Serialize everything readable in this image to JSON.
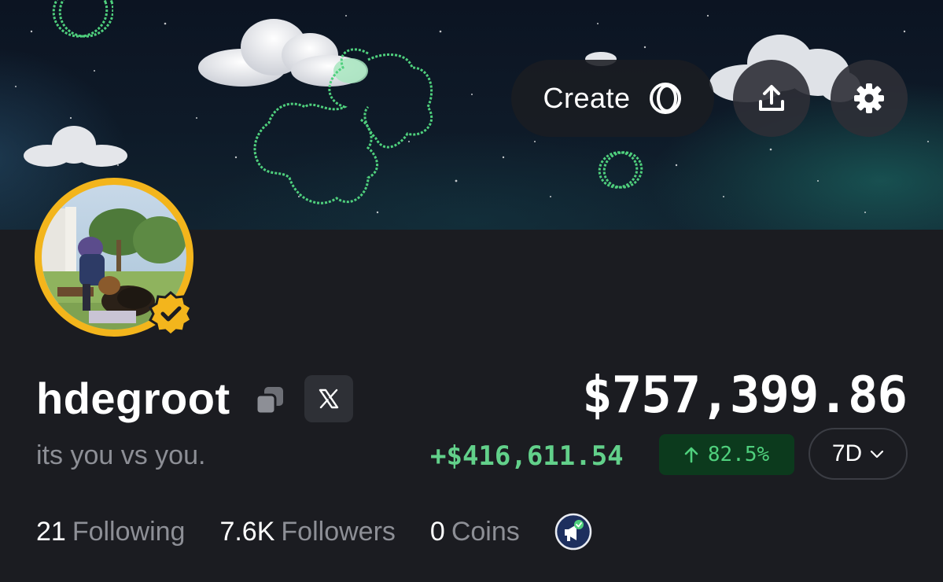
{
  "header": {
    "create_label": "Create",
    "create_icon": "coin-ring-icon",
    "share_icon": "share-upload-icon",
    "settings_icon": "gear-icon"
  },
  "profile": {
    "username": "hdegroot",
    "bio": "its you vs you.",
    "verified": true,
    "copy_icon": "copy-icon",
    "social_icon": "x-logo-icon"
  },
  "portfolio": {
    "balance": "$757,399.86",
    "change_amount": "+$416,611.54",
    "change_percent": "82.5%",
    "period": "7D"
  },
  "stats": {
    "following_count": "21",
    "following_label": "Following",
    "followers_count": "7.6K",
    "followers_label": "Followers",
    "coins_count": "0",
    "coins_label": "Coins"
  },
  "colors": {
    "background": "#1b1c21",
    "accent_gold": "#f3b51c",
    "positive_green": "#62d08a",
    "positive_badge_bg": "#0c3a1d",
    "muted_text": "#8d8f96"
  }
}
